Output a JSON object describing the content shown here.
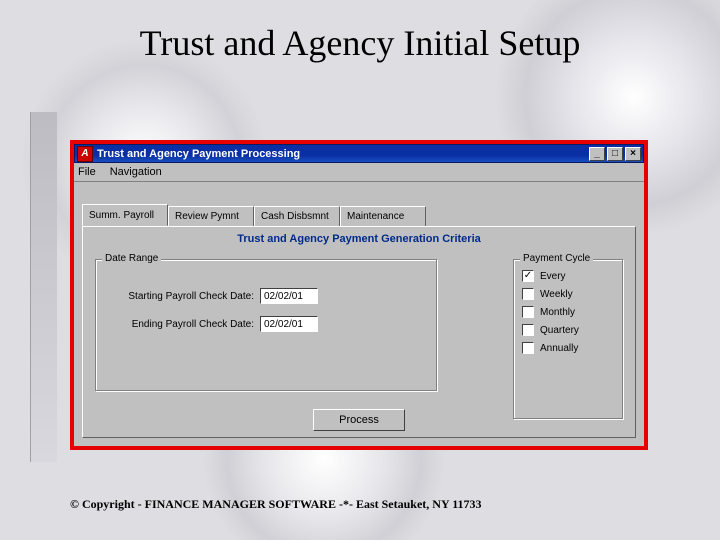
{
  "slide": {
    "title": "Trust and Agency Initial Setup",
    "copyright": "© Copyright - FINANCE MANAGER SOFTWARE -*- East Setauket, NY 11733"
  },
  "window": {
    "app_glyph": "A",
    "title": "Trust and Agency Payment Processing",
    "menu": {
      "file": "File",
      "navigation": "Navigation"
    },
    "sysbuttons": {
      "min": "_",
      "max": "□",
      "close": "×"
    }
  },
  "tabs": [
    {
      "id": "summ",
      "label": "Summ. Payroll"
    },
    {
      "id": "review",
      "label": "Review Pymnt"
    },
    {
      "id": "cash",
      "label": "Cash Disbsmnt"
    },
    {
      "id": "maint",
      "label": "Maintenance"
    }
  ],
  "panel": {
    "title": "Trust and Agency Payment Generation Criteria",
    "date_range": {
      "legend": "Date Range",
      "start_label": "Starting Payroll Check Date:",
      "start_value": "02/02/01",
      "end_label": "Ending Payroll Check Date:",
      "end_value": "02/02/01"
    },
    "cycle": {
      "legend": "Payment Cycle",
      "options": [
        {
          "label": "Every",
          "checked": true
        },
        {
          "label": "Weekly",
          "checked": false
        },
        {
          "label": "Monthly",
          "checked": false
        },
        {
          "label": "Quartery",
          "checked": false
        },
        {
          "label": "Annually",
          "checked": false
        }
      ]
    },
    "process_label": "Process"
  }
}
